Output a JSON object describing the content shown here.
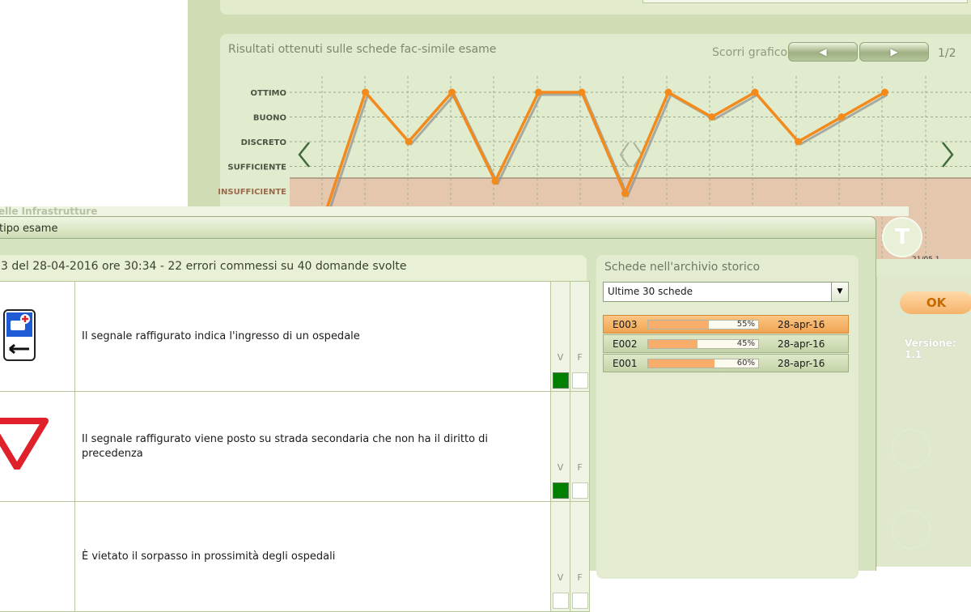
{
  "back_window": {
    "chart_panel": {
      "title": "Risultati ottenuti sulle schede fac-simile esame",
      "scroll_label": "Scorri grafico",
      "page_indicator": "1/2",
      "prev_icon": "triangle-left-icon",
      "next_icon": "triangle-right-icon",
      "x_tick_last": "21/05.1"
    },
    "ok_label": "OK",
    "version_label": "Versione: 1.1",
    "logo_letter": "T"
  },
  "chart_data": {
    "type": "line",
    "title": "Risultati ottenuti sulle schede fac-simile esame",
    "y_categories": [
      "INSUFFICIENTE",
      "SUFFICIENTE",
      "DISCRETO",
      "BUONO",
      "OTTIMO"
    ],
    "y_levels": {
      "INSUFFICIENTE": 0,
      "SUFFICIENTE": 1,
      "DISCRETO": 2,
      "BUONO": 3,
      "OTTIMO": 4
    },
    "series": [
      {
        "values": [
          -1.3,
          4,
          2,
          4,
          0.4,
          4,
          4,
          -0.1,
          4,
          3,
          4,
          2,
          3,
          4
        ]
      }
    ],
    "x_labels": [
      "",
      "",
      "",
      "",
      "",
      "",
      "",
      "",
      "",
      "",
      "",
      "",
      "",
      "21/05.1"
    ],
    "grid": true,
    "colors": {
      "line": "#f28a1c",
      "shadow": "#8f8f8f",
      "insufficient_band": "#e4c7ad"
    }
  },
  "front_window": {
    "ministry_text": "elle Infrastrutture",
    "title": "tipo esame",
    "test_summary": "3 del 28-04-2016 ore 30:34 - 22 errori commessi su 40 domande svolte",
    "columns": {
      "v": "V",
      "f": "F"
    },
    "questions": [
      {
        "icon": "hospital-sign-icon",
        "text": "Il segnale raffigurato indica l'ingresso di un ospedale",
        "answer": "V"
      },
      {
        "icon": "yield-sign-icon",
        "text": "Il segnale raffigurato viene posto su strada secondaria che non ha il diritto di precedenza",
        "answer": "V"
      },
      {
        "icon": "",
        "text": "È vietato il sorpasso in prossimità degli ospedali",
        "answer": ""
      }
    ],
    "archive": {
      "title": "Schede nell'archivio storico",
      "select_value": "Ultime 30 schede",
      "rows": [
        {
          "code": "E003",
          "percent": 55,
          "percent_label": "55%",
          "date": "28-apr-16",
          "selected": true
        },
        {
          "code": "E002",
          "percent": 45,
          "percent_label": "45%",
          "date": "28-apr-16",
          "selected": false
        },
        {
          "code": "E001",
          "percent": 60,
          "percent_label": "60%",
          "date": "28-apr-16",
          "selected": false
        }
      ]
    }
  }
}
